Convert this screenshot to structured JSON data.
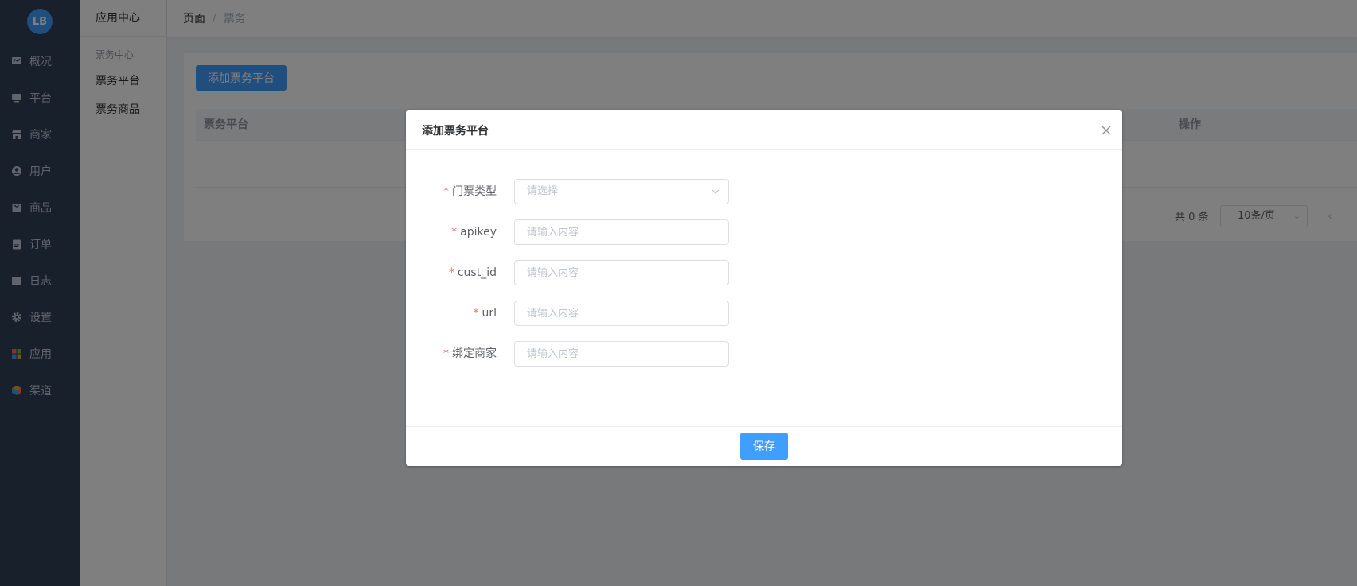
{
  "logo": {
    "text": "LB",
    "icon": "logo-icon"
  },
  "nav": {
    "items": [
      {
        "label": "概况",
        "icon": "chart-icon"
      },
      {
        "label": "平台",
        "icon": "monitor-icon"
      },
      {
        "label": "商家",
        "icon": "store-icon"
      },
      {
        "label": "用户",
        "icon": "user-icon"
      },
      {
        "label": "商品",
        "icon": "bag-icon"
      },
      {
        "label": "订单",
        "icon": "clipboard-icon"
      },
      {
        "label": "日志",
        "icon": "book-icon"
      },
      {
        "label": "设置",
        "icon": "gear-icon"
      },
      {
        "label": "应用",
        "icon": "apps-icon"
      },
      {
        "label": "渠道",
        "icon": "cube-icon"
      }
    ]
  },
  "subnav": {
    "title": "应用中心",
    "group": "票务中心",
    "items": [
      {
        "label": "票务平台"
      },
      {
        "label": "票务商品"
      }
    ]
  },
  "breadcrumb": {
    "root": "页面",
    "separator": "/",
    "current": "票务"
  },
  "main": {
    "add_button": "添加票务平台",
    "table": {
      "col_platform": "票务平台",
      "col_actions": "操作"
    },
    "pagination": {
      "total": "共 0 条",
      "page_size": "10条/页"
    }
  },
  "dialog": {
    "title": "添加票务平台",
    "fields": [
      {
        "label": "门票类型",
        "placeholder": "请选择",
        "type": "select"
      },
      {
        "label": "apikey",
        "placeholder": "请输入内容"
      },
      {
        "label": "cust_id",
        "placeholder": "请输入内容"
      },
      {
        "label": "url",
        "placeholder": "请输入内容"
      },
      {
        "label": "绑定商家",
        "placeholder": "请输入内容"
      }
    ],
    "required_mark": "*",
    "save_button": "保存"
  },
  "colors": {
    "primary": "#409eff",
    "sidebar": "#304156",
    "required": "#f56c6c"
  }
}
